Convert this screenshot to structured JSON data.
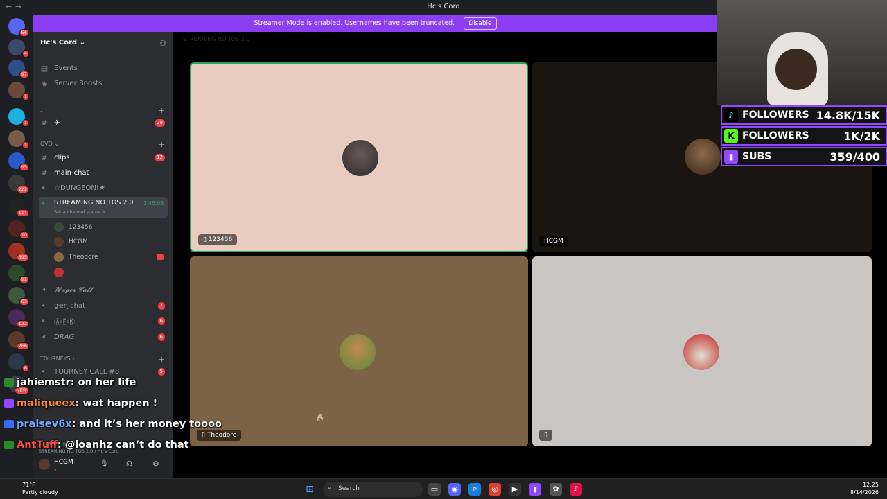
{
  "titlebar": {
    "title": "Hc's Cord",
    "back": "←",
    "forward": "→"
  },
  "banner": {
    "text": "Streamer Mode is enabled. Usernames have been truncated.",
    "button": "Disable"
  },
  "guild_badges": [
    "56",
    "4",
    "97",
    "1",
    "1",
    "1",
    "95",
    "222",
    "114",
    "10",
    "395",
    "92",
    "65",
    "133",
    "266",
    "6",
    "NEW"
  ],
  "server": {
    "name": "Hc's Cord ⌄"
  },
  "sidebar": {
    "events": "Events",
    "boosts": "Server Boosts",
    "cat1": ".",
    "chan_plane": "✈",
    "chan_plane_badge": "29",
    "cat_ovo": "OVO ⌄",
    "clips": "clips",
    "clips_badge": "12",
    "main_chat": "main-chat",
    "dungeon": "☆DUNGEON!★",
    "streaming": "STREAMING NO TOS 2.0",
    "streaming_time": "1:45:06",
    "streaming_status": "Set a channel status ✎",
    "voice_users": [
      "123456",
      "HCGM",
      "Theodore",
      ""
    ],
    "wager": "𝓦𝓪𝓰𝓮𝓻 𝓒𝓪𝓵𝓵",
    "gen_chat": "ցҽղ ϲհat",
    "gen_chat_badge": "7",
    "afk": "ⒶⒻⓀ",
    "afk_badge": "6",
    "drag": "DRAG",
    "drag_badge": "6",
    "cat_tourneys": "TOURNEYS ›",
    "tourney": "TOURNEY CALL #8",
    "tourney_badge": "5"
  },
  "userbar": {
    "voice_connected": "Voice Connected",
    "voice_channel": "STREAMING NO TOS 2.0 / Hc's Cord",
    "username": "HCGM",
    "status": "x..."
  },
  "stage": {
    "header": "STREAMING NO TOS 2.0",
    "tiles": [
      {
        "tag": "123456"
      },
      {
        "tag": "HCGM"
      },
      {
        "tag": "Theodore"
      },
      {
        "tag": ""
      }
    ]
  },
  "overlay": {
    "stats": [
      {
        "label": "FOLLOWERS",
        "value": "14.8K/15K"
      },
      {
        "label": "FOLLOWERS",
        "value": "1K/2K"
      },
      {
        "label": "SUBS",
        "value": "359/400"
      }
    ],
    "chat": [
      {
        "user": "jahiemstr",
        "msg": ": on her life",
        "color": "#ffffff"
      },
      {
        "user": "maliqueex",
        "msg": ": wat happen !",
        "color": "#ff8a3a"
      },
      {
        "user": "praisev6x",
        "msg": ": and it’s her money toooo",
        "color": "#6aa8ff"
      },
      {
        "user": "AntTuff",
        "msg": ": @loanhz can’t do that",
        "color": "#ff4a4a"
      }
    ]
  },
  "taskbar": {
    "temp": "71°F",
    "weather": "Partly cloudy",
    "search": "Search",
    "time": "12:25",
    "date": "8/14/2026"
  },
  "colors": {
    "accent": "#8b3ef2",
    "tile1": "#e7ccbf",
    "tile2": "#1a1510",
    "tile3": "#7c6346",
    "tile4": "#c8c5c2"
  }
}
